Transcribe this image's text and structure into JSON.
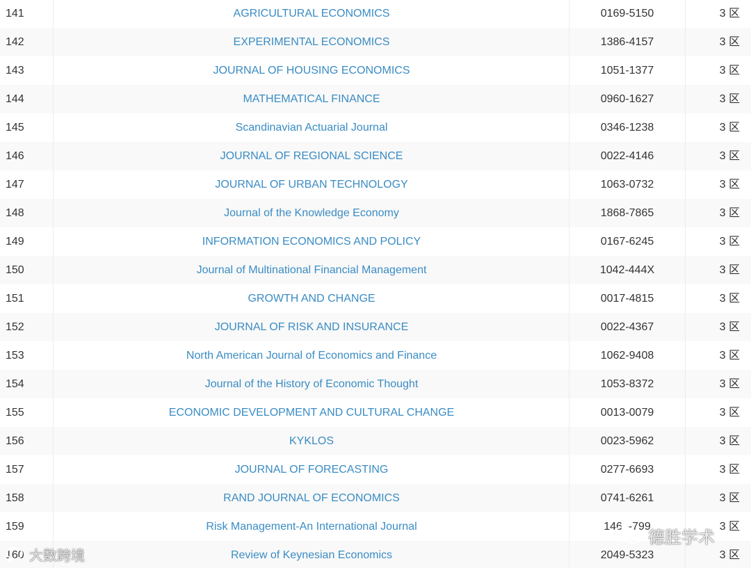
{
  "table": {
    "rows": [
      {
        "no": "141",
        "title": "AGRICULTURAL ECONOMICS",
        "issn": "0169-5150",
        "zone": "3 区"
      },
      {
        "no": "142",
        "title": "EXPERIMENTAL ECONOMICS",
        "issn": "1386-4157",
        "zone": "3 区"
      },
      {
        "no": "143",
        "title": "JOURNAL OF HOUSING ECONOMICS",
        "issn": "1051-1377",
        "zone": "3 区"
      },
      {
        "no": "144",
        "title": "MATHEMATICAL FINANCE",
        "issn": "0960-1627",
        "zone": "3 区"
      },
      {
        "no": "145",
        "title": "Scandinavian Actuarial Journal",
        "issn": "0346-1238",
        "zone": "3 区"
      },
      {
        "no": "146",
        "title": "JOURNAL OF REGIONAL SCIENCE",
        "issn": "0022-4146",
        "zone": "3 区"
      },
      {
        "no": "147",
        "title": "JOURNAL OF URBAN TECHNOLOGY",
        "issn": "1063-0732",
        "zone": "3 区"
      },
      {
        "no": "148",
        "title": "Journal of the Knowledge Economy",
        "issn": "1868-7865",
        "zone": "3 区"
      },
      {
        "no": "149",
        "title": "INFORMATION ECONOMICS AND POLICY",
        "issn": "0167-6245",
        "zone": "3 区"
      },
      {
        "no": "150",
        "title": "Journal of Multinational Financial Management",
        "issn": "1042-444X",
        "zone": "3 区"
      },
      {
        "no": "151",
        "title": "GROWTH AND CHANGE",
        "issn": "0017-4815",
        "zone": "3 区"
      },
      {
        "no": "152",
        "title": "JOURNAL OF RISK AND INSURANCE",
        "issn": "0022-4367",
        "zone": "3 区"
      },
      {
        "no": "153",
        "title": "North American Journal of Economics and Finance",
        "issn": "1062-9408",
        "zone": "3 区"
      },
      {
        "no": "154",
        "title": "Journal of the History of Economic Thought",
        "issn": "1053-8372",
        "zone": "3 区"
      },
      {
        "no": "155",
        "title": "ECONOMIC DEVELOPMENT AND CULTURAL CHANGE",
        "issn": "0013-0079",
        "zone": "3 区"
      },
      {
        "no": "156",
        "title": "KYKLOS",
        "issn": "0023-5962",
        "zone": "3 区"
      },
      {
        "no": "157",
        "title": "JOURNAL OF FORECASTING",
        "issn": "0277-6693",
        "zone": "3 区"
      },
      {
        "no": "158",
        "title": "RAND JOURNAL OF ECONOMICS",
        "issn": "0741-6261",
        "zone": "3 区"
      },
      {
        "no": "159",
        "title": "Risk Management-An International Journal",
        "issn": "146  -799",
        "zone": "3 区"
      },
      {
        "no": "160",
        "title": "Review of Keynesian Economics",
        "issn": "2049-5323",
        "zone": "3 区"
      }
    ]
  },
  "watermark_left": {
    "icon": "chat-bubble-icon",
    "text": "大数跨境"
  },
  "watermark_right": {
    "icon": "wechat-icon",
    "text": "德胜学术"
  }
}
